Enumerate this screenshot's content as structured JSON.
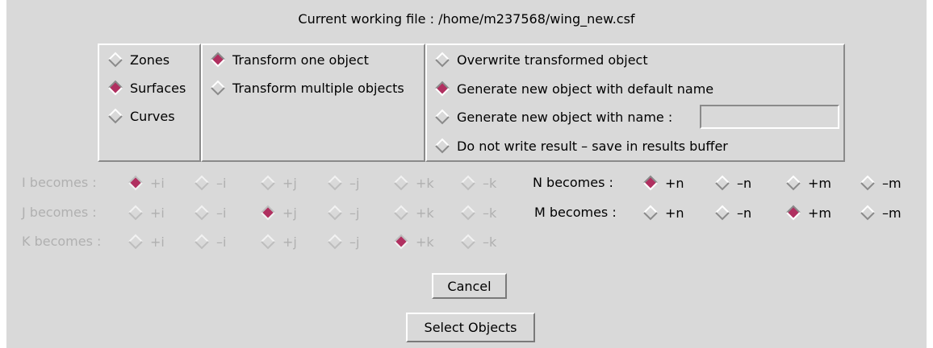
{
  "header": {
    "title": "Current working file : /home/m237568/wing_new.csf"
  },
  "object_type": {
    "options": [
      {
        "label": "Zones",
        "selected": false
      },
      {
        "label": "Surfaces",
        "selected": true
      },
      {
        "label": "Curves",
        "selected": false
      }
    ]
  },
  "transform_mode": {
    "options": [
      {
        "label": "Transform one object",
        "selected": true
      },
      {
        "label": "Transform multiple objects",
        "selected": false
      }
    ]
  },
  "output_mode": {
    "options": [
      {
        "label": "Overwrite transformed object",
        "selected": false
      },
      {
        "label": "Generate new object with default name",
        "selected": true
      },
      {
        "label": "Generate new object with name :",
        "selected": false
      },
      {
        "label": "Do not write result – save in results buffer",
        "selected": false
      }
    ],
    "name_value": ""
  },
  "index_mapping": {
    "rows": [
      {
        "label": "I becomes :",
        "enabled": false,
        "options": [
          "+i",
          "–i",
          "+j",
          "–j",
          "+k",
          "–k"
        ],
        "selected": 0
      },
      {
        "label": "J becomes :",
        "enabled": false,
        "options": [
          "+i",
          "–i",
          "+j",
          "–j",
          "+k",
          "–k"
        ],
        "selected": 2
      },
      {
        "label": "K becomes :",
        "enabled": false,
        "options": [
          "+i",
          "–i",
          "+j",
          "–j",
          "+k",
          "–k"
        ],
        "selected": 4
      }
    ]
  },
  "surface_mapping": {
    "rows": [
      {
        "label": "N becomes :",
        "enabled": true,
        "options": [
          "+n",
          "–n",
          "+m",
          "–m"
        ],
        "selected": 0
      },
      {
        "label": "M becomes :",
        "enabled": true,
        "options": [
          "+n",
          "–n",
          "+m",
          "–m"
        ],
        "selected": 2
      }
    ]
  },
  "buttons": {
    "cancel": "Cancel",
    "select_objects": "Select Objects"
  },
  "colors": {
    "background": "#d9d9d9",
    "selected_radio": "#b03060",
    "disabled_text": "#b0b0b0"
  }
}
